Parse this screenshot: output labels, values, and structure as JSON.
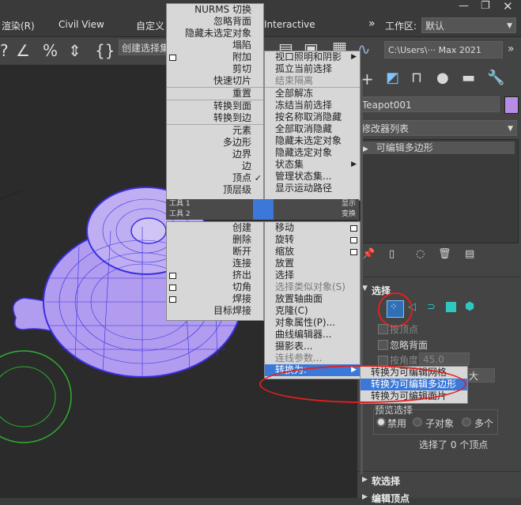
{
  "menubar": {
    "items": [
      "渲染(R)",
      "Civil View",
      "自定义",
      "Interactive"
    ],
    "workspace_label": "工作区:",
    "workspace_value": "默认",
    "path_value": "C:\\Users\\··· Max 2021",
    "chevron": "»",
    "window_controls": [
      "minimize-icon",
      "restore-icon",
      "close-icon"
    ]
  },
  "toolbar": {
    "selection_set_placeholder": "创建选择集",
    "icons": [
      "snap-toggle-icon",
      "angle-snap-icon",
      "percent-snap-icon",
      "spinner-snap-icon",
      "named-selection-icon",
      "layer-explorer-icon",
      "ribbon-icon",
      "material-editor-icon",
      "curve-editor-icon"
    ]
  },
  "quad_menu": {
    "left_top": [
      {
        "label": "NURMS 切换"
      },
      {
        "label": "忽略背面"
      },
      {
        "label": "隐藏未选定对象"
      },
      {
        "label": "塌陷"
      },
      {
        "label": "附加",
        "settings": true
      },
      {
        "label": "剪切"
      },
      {
        "label": "快速切片"
      },
      {
        "sep": true
      },
      {
        "label": "重置"
      },
      {
        "sep": true
      },
      {
        "label": "转换到面"
      },
      {
        "label": "转换到边"
      },
      {
        "sep": true
      },
      {
        "label": "元素"
      },
      {
        "label": "多边形"
      },
      {
        "label": "边界"
      },
      {
        "label": "边"
      },
      {
        "label": "顶点"
      },
      {
        "label": "顶层级"
      }
    ],
    "left_top_checked_index": 17,
    "hdr_left_1": "工具 1",
    "hdr_right_1": "显示",
    "hdr_left_2": "工具 2",
    "hdr_right_2": "变换",
    "left_bottom": [
      {
        "label": "创建"
      },
      {
        "label": "删除"
      },
      {
        "label": "断开"
      },
      {
        "label": "连接"
      },
      {
        "label": "挤出",
        "settings": true
      },
      {
        "label": "切角",
        "settings": true
      },
      {
        "label": "焊接",
        "settings": true
      },
      {
        "label": "目标焊接"
      }
    ],
    "right_top": [
      {
        "label": "视口照明和阴影",
        "arrow": true
      },
      {
        "label": "孤立当前选择"
      },
      {
        "label": "结束隔离",
        "dim": true
      },
      {
        "sep": true
      },
      {
        "label": "全部解冻"
      },
      {
        "label": "冻结当前选择"
      },
      {
        "label": "按名称取消隐藏"
      },
      {
        "label": "全部取消隐藏"
      },
      {
        "label": "隐藏未选定对象"
      },
      {
        "label": "隐藏选定对象"
      },
      {
        "label": "状态集",
        "arrow": true
      },
      {
        "label": "管理状态集..."
      },
      {
        "label": "显示运动路径"
      }
    ],
    "right_bottom": [
      {
        "label": "移动",
        "settings": true
      },
      {
        "label": "旋转",
        "settings": true
      },
      {
        "label": "缩放",
        "settings": true
      },
      {
        "label": "放置"
      },
      {
        "label": "选择"
      },
      {
        "label": "选择类似对象(S)",
        "dim": true
      },
      {
        "label": "放置轴曲面"
      },
      {
        "label": "克隆(C)"
      },
      {
        "label": "对象属性(P)..."
      },
      {
        "label": "曲线编辑器..."
      },
      {
        "label": "摄影表..."
      },
      {
        "label": "连线参数...",
        "dim": true
      },
      {
        "label": "转换为:",
        "arrow": true,
        "selected": true
      }
    ],
    "submenu": [
      {
        "label": "转换为可编辑网格"
      },
      {
        "label": "转换为可编辑多边形",
        "selected": true
      },
      {
        "label": "转换为可编辑面片"
      }
    ]
  },
  "command_panel": {
    "tab_icons": [
      "create-tab-icon",
      "modify-tab-icon",
      "hierarchy-tab-icon",
      "motion-tab-icon",
      "display-tab-icon",
      "utilities-tab-icon"
    ],
    "object_name": "Teapot001",
    "object_color": "#b58de6",
    "modifier_list": "修改器列表",
    "stack_item": "可编辑多边形",
    "section_selection": "选择",
    "by_vertex": "按顶点",
    "ignore_backfacing": "忽略背面",
    "by_angle": "按角度",
    "angle_value": "45.0",
    "grow_label": "大",
    "preview_label": "预览选择",
    "preview_options": [
      "禁用",
      "子对象",
      "多个"
    ],
    "preview_selected": 0,
    "status": "选择了 0 个顶点",
    "section_soft": "软选择",
    "section_edit": "编辑顶点"
  },
  "colors": {
    "accent": "#3b78d8",
    "highlight_ring": "#e02020",
    "mesh": "#3a2fe0",
    "mesh_fill": "#b29cf0",
    "gizmo": "#2fb030"
  }
}
